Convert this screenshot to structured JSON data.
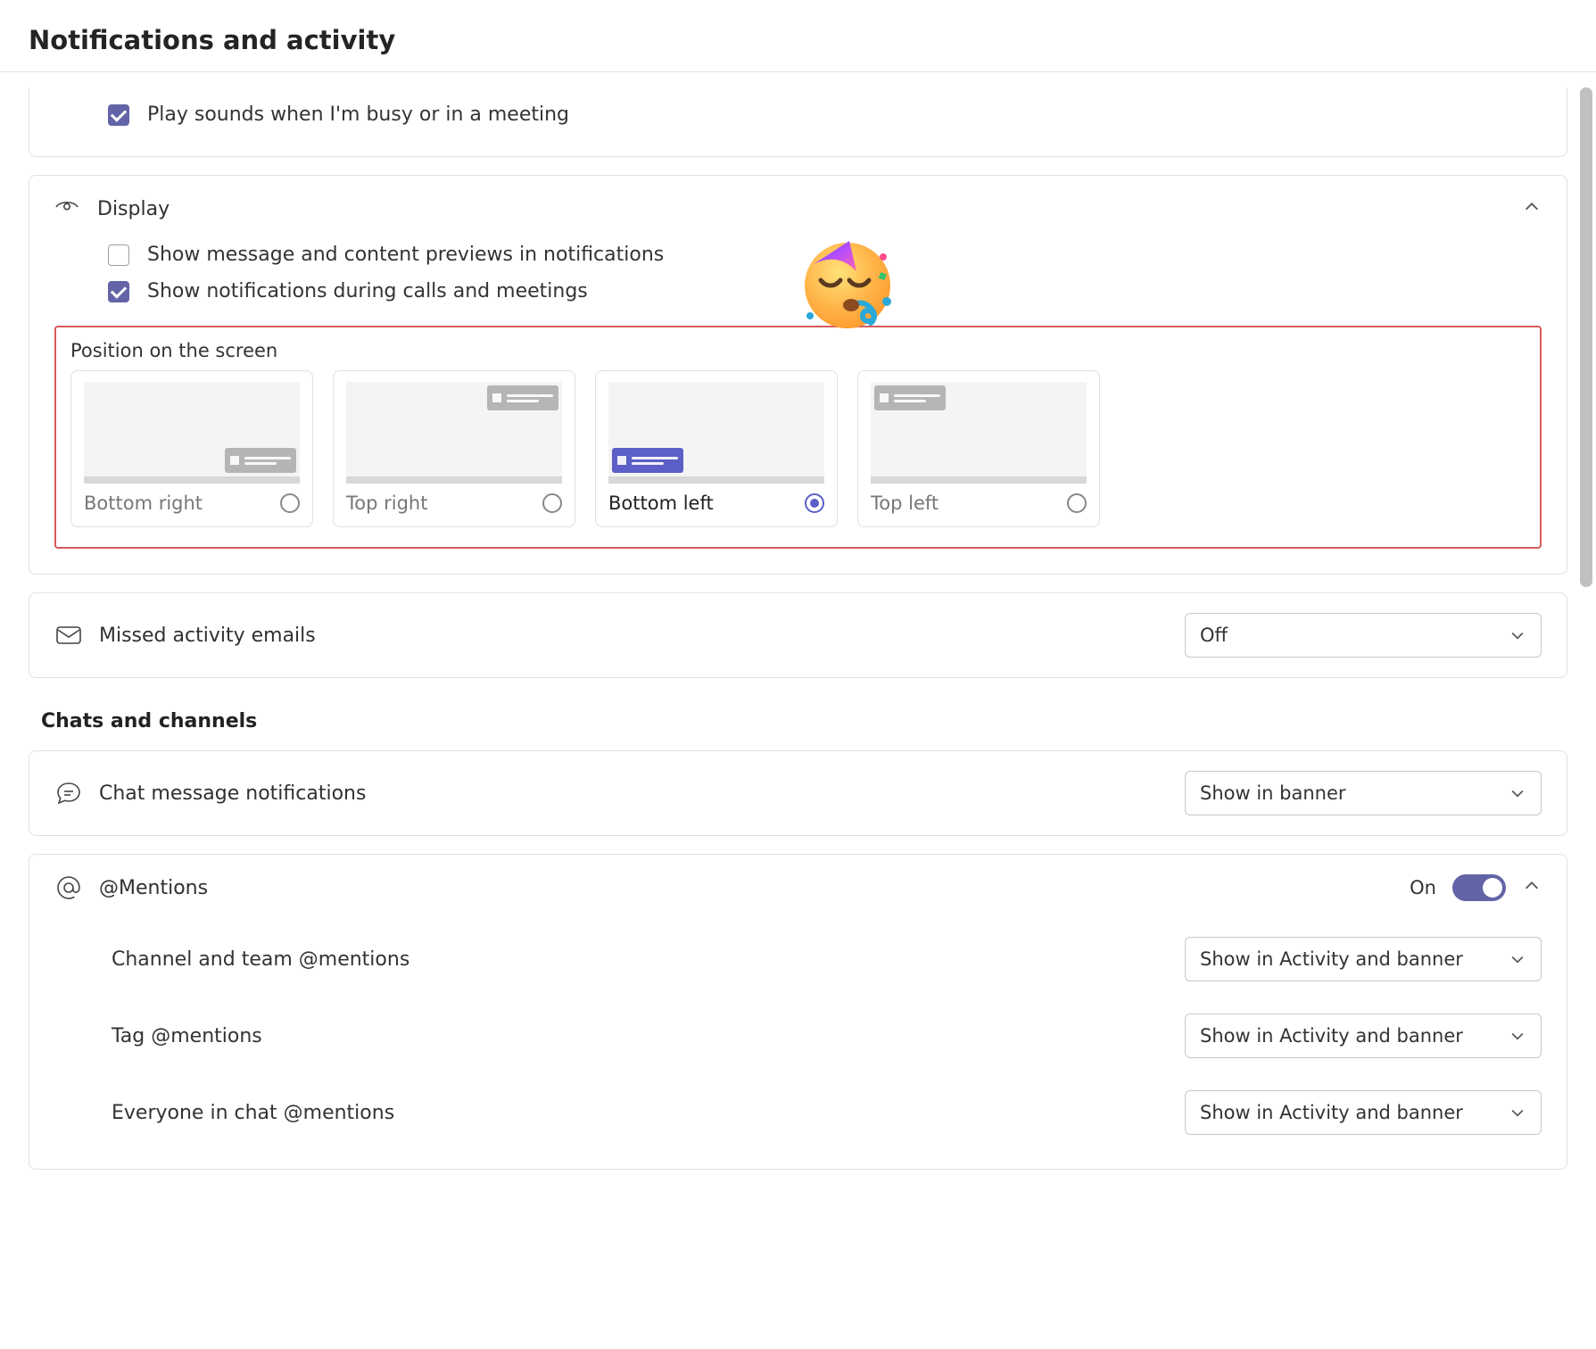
{
  "page": {
    "title": "Notifications and activity"
  },
  "sounds": {
    "busy_meeting": {
      "label": "Play sounds when I'm busy or in a meeting",
      "checked": true
    }
  },
  "display": {
    "title": "Display",
    "expanded": true,
    "preview_opt": {
      "label": "Show message and content previews in notifications",
      "checked": false
    },
    "calls_opt": {
      "label": "Show notifications during calls and meetings",
      "checked": true
    },
    "position": {
      "title": "Position on the screen",
      "selected": "bottom_left",
      "options": [
        {
          "id": "bottom_right",
          "label": "Bottom right",
          "toast_pos": "br",
          "selected": false
        },
        {
          "id": "top_right",
          "label": "Top right",
          "toast_pos": "tr",
          "selected": false
        },
        {
          "id": "bottom_left",
          "label": "Bottom left",
          "toast_pos": "bl",
          "selected": true
        },
        {
          "id": "top_left",
          "label": "Top left",
          "toast_pos": "tl",
          "selected": false
        }
      ]
    }
  },
  "missed_emails": {
    "label": "Missed activity emails",
    "value": "Off"
  },
  "chats_heading": "Chats and channels",
  "chat_notifications": {
    "label": "Chat message notifications",
    "value": "Show in banner"
  },
  "mentions": {
    "title": "@Mentions",
    "toggle_label": "On",
    "toggle_on": true,
    "expanded": true,
    "rows": [
      {
        "label": "Channel and team @mentions",
        "value": "Show in Activity and banner"
      },
      {
        "label": "Tag @mentions",
        "value": "Show in Activity and banner"
      },
      {
        "label": "Everyone in chat @mentions",
        "value": "Show in Activity and banner"
      }
    ]
  }
}
